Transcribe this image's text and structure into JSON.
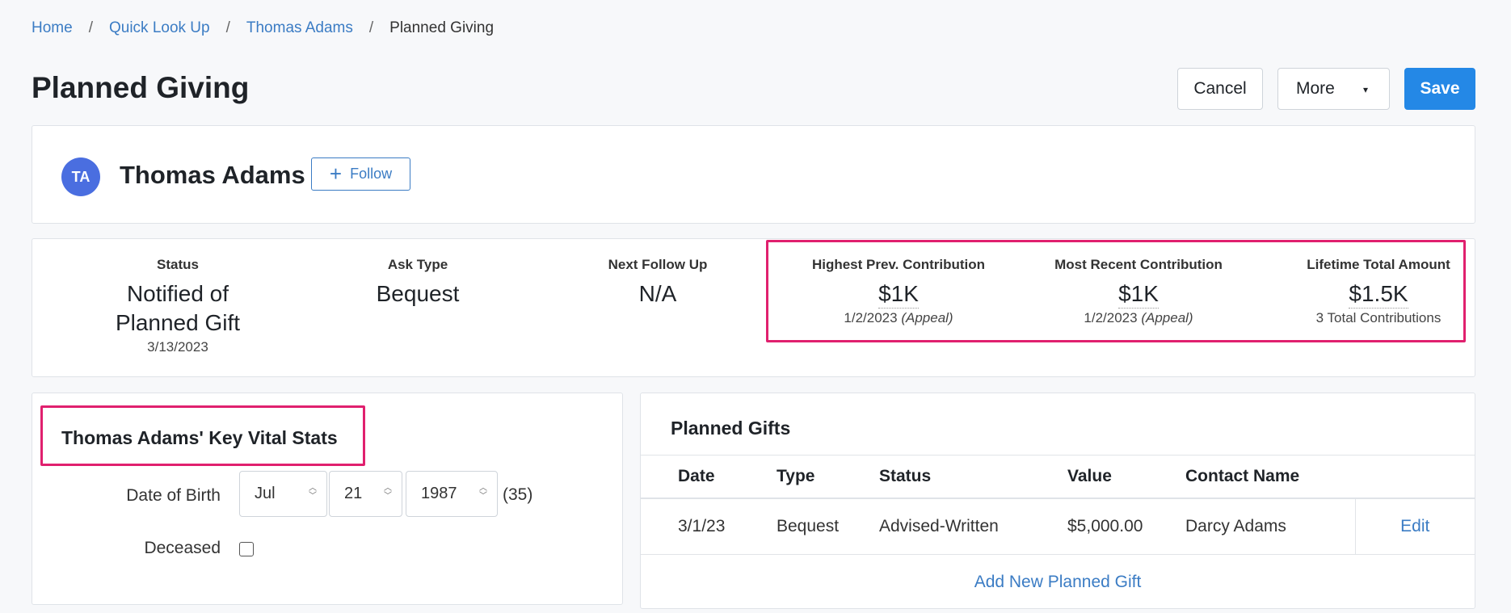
{
  "breadcrumb": {
    "items": [
      "Home",
      "Quick Look Up",
      "Thomas Adams"
    ],
    "current": "Planned Giving",
    "separator": "/"
  },
  "page_title": "Planned Giving",
  "header_buttons": {
    "cancel": "Cancel",
    "more": "More",
    "save": "Save",
    "more_caret": "▾"
  },
  "person": {
    "initials": "TA",
    "name": "Thomas Adams",
    "follow_label": "Follow",
    "follow_icon": "+"
  },
  "stats": [
    {
      "label": "Status",
      "value": "Notified of Planned Gift",
      "sub": "3/13/2023"
    },
    {
      "label": "Ask Type",
      "value": "Bequest",
      "sub": ""
    },
    {
      "label": "Next Follow Up",
      "value": "N/A",
      "sub": ""
    }
  ],
  "contributions": [
    {
      "label": "Highest Prev. Contribution",
      "value": "$1K",
      "sub_date": "1/2/2023",
      "sub_note": "(Appeal)"
    },
    {
      "label": "Most Recent Contribution",
      "value": "$1K",
      "sub_date": "1/2/2023",
      "sub_note": "(Appeal)"
    },
    {
      "label": "Lifetime Total Amount",
      "value": "$1.5K",
      "sub_date": "3 Total Contributions",
      "sub_note": ""
    }
  ],
  "vitals": {
    "title": "Thomas Adams' Key Vital Stats",
    "dob_label": "Date of Birth",
    "dob_month": "Jul",
    "dob_day": "21",
    "dob_year": "1987",
    "age": "(35)",
    "deceased_label": "Deceased",
    "deceased_checked": false
  },
  "planned_gifts": {
    "title": "Planned Gifts",
    "columns": [
      "Date",
      "Type",
      "Status",
      "Value",
      "Contact Name"
    ],
    "rows": [
      {
        "date": "3/1/23",
        "type": "Bequest",
        "status": "Advised-Written",
        "value": "$5,000.00",
        "contact": "Darcy Adams",
        "action": "Edit"
      }
    ],
    "add_label": "Add New Planned Gift"
  },
  "colors": {
    "accent": "#2488e6",
    "link": "#3b7cc4",
    "highlight": "#e0206e",
    "avatar": "#4a6ee0"
  }
}
